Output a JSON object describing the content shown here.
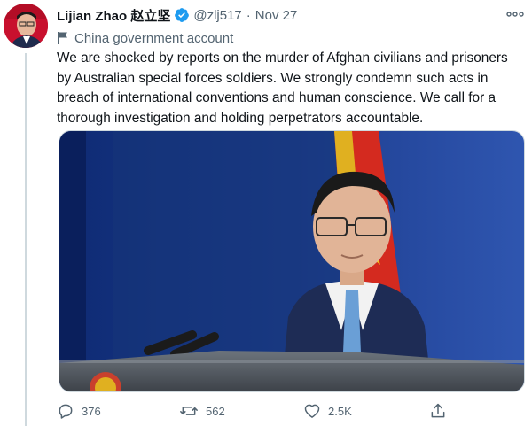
{
  "tweet": {
    "author": {
      "display_name": "Lijian Zhao 赵立坚",
      "handle": "@zlj517",
      "verified": true,
      "avatar_icon": "avatar-photo"
    },
    "separator": "·",
    "date": "Nov 27",
    "account_label": "China government account",
    "text_lines": [
      "We are shocked by reports on the murder of Afghan civilians and prisoners",
      "by Australian special forces soldiers. We strongly condemn such acts in",
      "breach of international conventions and human conscience. We call for a",
      "thorough investigation and holding perpetrators accountable."
    ],
    "media": {
      "description_icon": "press-conference-photo"
    },
    "actions": {
      "reply_count": "376",
      "retweet_count": "562",
      "like_count": "2.5K"
    }
  },
  "colors": {
    "text_primary": "#0f1419",
    "text_secondary": "#536471",
    "verified_blue": "#1d9bf0",
    "border": "#cfd9de",
    "photo_background": "#1d3d8f"
  }
}
